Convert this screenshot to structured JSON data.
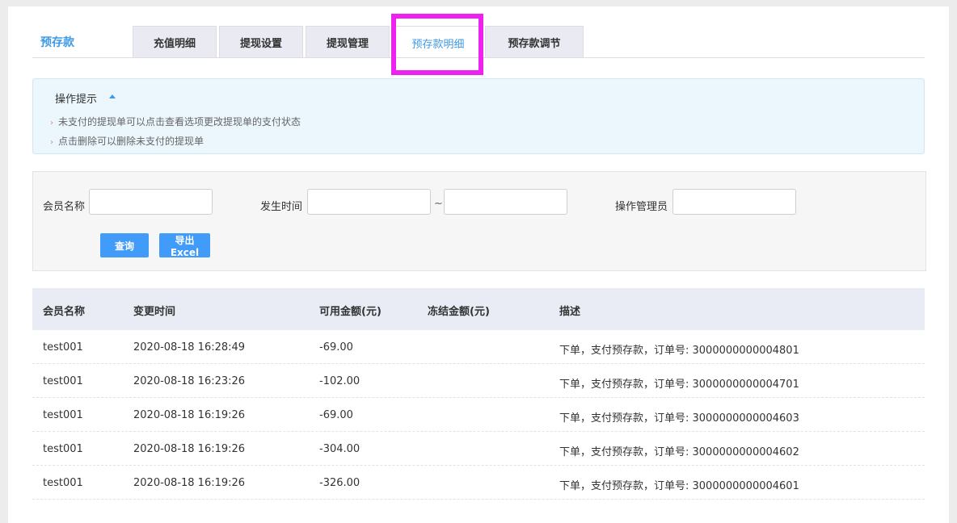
{
  "header": {
    "title": "预存款",
    "tabs": [
      {
        "label": "充值明细",
        "active": false
      },
      {
        "label": "提现设置",
        "active": false
      },
      {
        "label": "提现管理",
        "active": false
      },
      {
        "label": "预存款明细",
        "active": true
      },
      {
        "label": "预存款调节",
        "active": false
      }
    ]
  },
  "tips": {
    "title": "操作提示",
    "items": [
      "未支付的提现单可以点击查看选项更改提现单的支付状态",
      "点击删除可以删除未支付的提现单"
    ]
  },
  "search": {
    "member_label": "会员名称",
    "member_value": "",
    "time_label": "发生时间",
    "time_from": "",
    "separator": "~",
    "time_to": "",
    "admin_label": "操作管理员",
    "admin_value": "",
    "query_button": "查询",
    "export_button": "导出Excel"
  },
  "table": {
    "columns": [
      "会员名称",
      "变更时间",
      "可用金额(元)",
      "冻结金额(元)",
      "描述"
    ],
    "rows": [
      {
        "member": "test001",
        "time": "2020-08-18 16:28:49",
        "available": "-69.00",
        "frozen": "",
        "desc": "下单，支付预存款，订单号: 3000000000004801"
      },
      {
        "member": "test001",
        "time": "2020-08-18 16:23:26",
        "available": "-102.00",
        "frozen": "",
        "desc": "下单，支付预存款，订单号: 3000000000004701"
      },
      {
        "member": "test001",
        "time": "2020-08-18 16:19:26",
        "available": "-69.00",
        "frozen": "",
        "desc": "下单，支付预存款，订单号: 3000000000004603"
      },
      {
        "member": "test001",
        "time": "2020-08-18 16:19:26",
        "available": "-304.00",
        "frozen": "",
        "desc": "下单，支付预存款，订单号: 3000000000004602"
      },
      {
        "member": "test001",
        "time": "2020-08-18 16:19:26",
        "available": "-326.00",
        "frozen": "",
        "desc": "下单，支付预存款，订单号: 3000000000004601"
      }
    ]
  },
  "colors": {
    "accent": "#3f9ae6",
    "button": "#419bf9",
    "highlight_box": "#ee22ee",
    "tips_background": "#ebf6fd",
    "table_header": "#e9ecf5"
  }
}
